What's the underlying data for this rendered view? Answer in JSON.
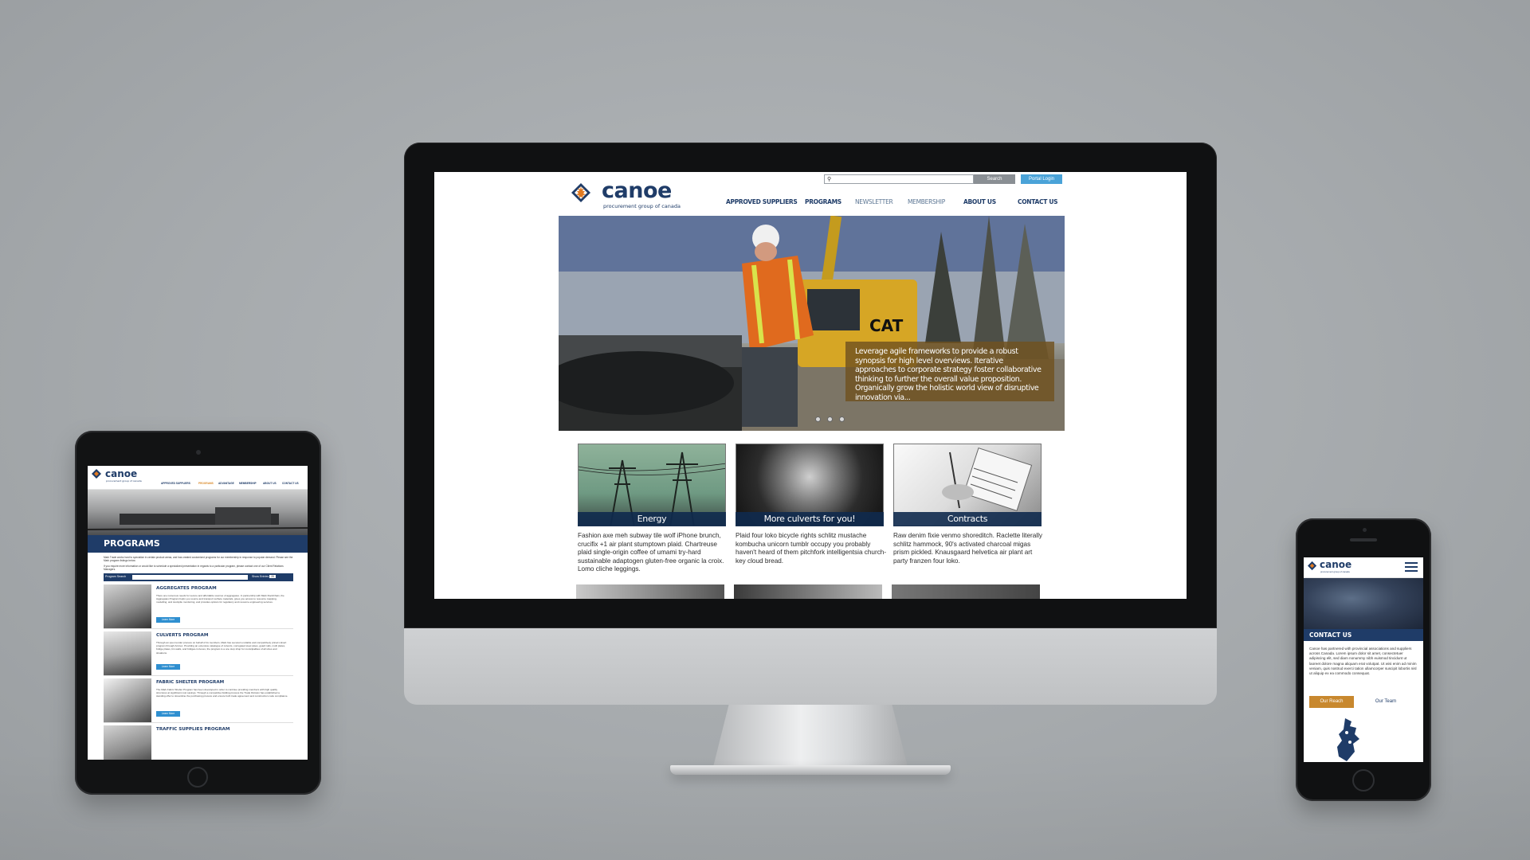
{
  "brand": {
    "name": "canoe",
    "tagline": "procurement group of canada",
    "primary_color": "#1f3c68",
    "accent_color": "#d9892a",
    "link_color": "#4aa3d8"
  },
  "desktop": {
    "search": {
      "placeholder": "",
      "button_label": "Search"
    },
    "portal_label": "Portal Login",
    "nav": [
      "APPROVED SUPPLIERS",
      "PROGRAMS",
      "NEWSLETTER",
      "MEMBERSHIP",
      "ABOUT US",
      "CONTACT US"
    ],
    "hero_caption": "Leverage agile frameworks to provide a robust synopsis for high level overviews. Iterative approaches to corporate strategy foster collaborative thinking to further the overall value proposition. Organically grow the holistic world view of disruptive innovation via...",
    "hero_logo_text": "CAT",
    "slider_dots": 3,
    "cards": [
      {
        "label": "Energy",
        "text": "Fashion axe meh subway tile wolf iPhone brunch, crucifix +1 air plant stumptown plaid. Chartreuse plaid single-origin coffee of umami try-hard sustainable adaptogen gluten-free organic la croix. Lomo cliche leggings."
      },
      {
        "label": "More culverts for you!",
        "text": "Plaid four loko bicycle rights schlitz mustache kombucha unicorn tumblr occupy you probably haven't heard of them pitchfork intelligentsia church-key cloud bread."
      },
      {
        "label": "Contracts",
        "text": "Raw denim fixie venmo shoreditch. Raclette literally schlitz hammock, 90's activated charcoal migas prism pickled. Knausgaard helvetica air plant art party franzen four loko."
      }
    ]
  },
  "tablet": {
    "nav": [
      "APPROVED SUPPLIERS",
      "PROGRAMS",
      "ADVANTAGE",
      "MEMBERSHIP",
      "ABOUT US",
      "CONTACT US"
    ],
    "page_title": "PROGRAMS",
    "intro_1": "Mark Trade works hard to specialize in certain product areas, and has created customized programs for our membership in response to popular demand. Please see the Mark program listings below.",
    "intro_2": "If you require more information or would like to schedule a specialized presentation in regards to a particular program, please contact one of our Client Relations Managers.",
    "filter": {
      "label": "Program Search",
      "show_label": "Show Entries",
      "show_value": "20"
    },
    "programs": [
      {
        "title": "AGGREGATES PROGRAM",
        "text": "There are numerous needs for secure and affordable sources of aggregates. In partnership with Mark RockChain, the Aggregates Program helps you source and transport surface materials, gives you access to resource mapping, modelling, and stockpile monitoring, and provides options for regulatory and resource engineering services.",
        "button": "Learn More"
      },
      {
        "title": "CULVERTS PROGRAM",
        "text": "Through an open tender process on behalf of its members, Mark has secured a reliable and competitively priced culvert program through Armtec. Providing an extensive catalogue of culverts, corrugated steel pipes, guard rails, multi plates, bridge plates, bin walls, and bridges-in-boxes, the program is a one stop shop for municipalities of all sizes and situations.",
        "button": "Learn More"
      },
      {
        "title": "FABRIC SHELTER PROGRAM",
        "text": "The Mark Fabric Shelter Program has been developed in order to continue providing members with high quality structures at significant cost savings. Through a competitive bidding process the Trade Division has established a standing offer to streamline the purchasing process and ensure both trade agreement and construction code compliance.",
        "button": "Learn More"
      },
      {
        "title": "TRAFFIC SUPPLIES PROGRAM",
        "text": "",
        "button": ""
      }
    ]
  },
  "phone": {
    "page_title": "CONTACT US",
    "text": "Canoe has partnered with provincial associations and suppliers across Canada. Lorem ipsum dolor sit amet, consectetuer adipiscing elit, sed diam nonummy nibh euismod tincidunt ut laoreet dolore magna aliquam erat volutpat. Ut wisi enim ad minim veniam, quis nostrud exerci tation ullamcorper suscipit lobortis nisl ut aliquip ex ea commodo consequat.",
    "button_primary": "Our Reach",
    "button_secondary": "Our Team"
  }
}
